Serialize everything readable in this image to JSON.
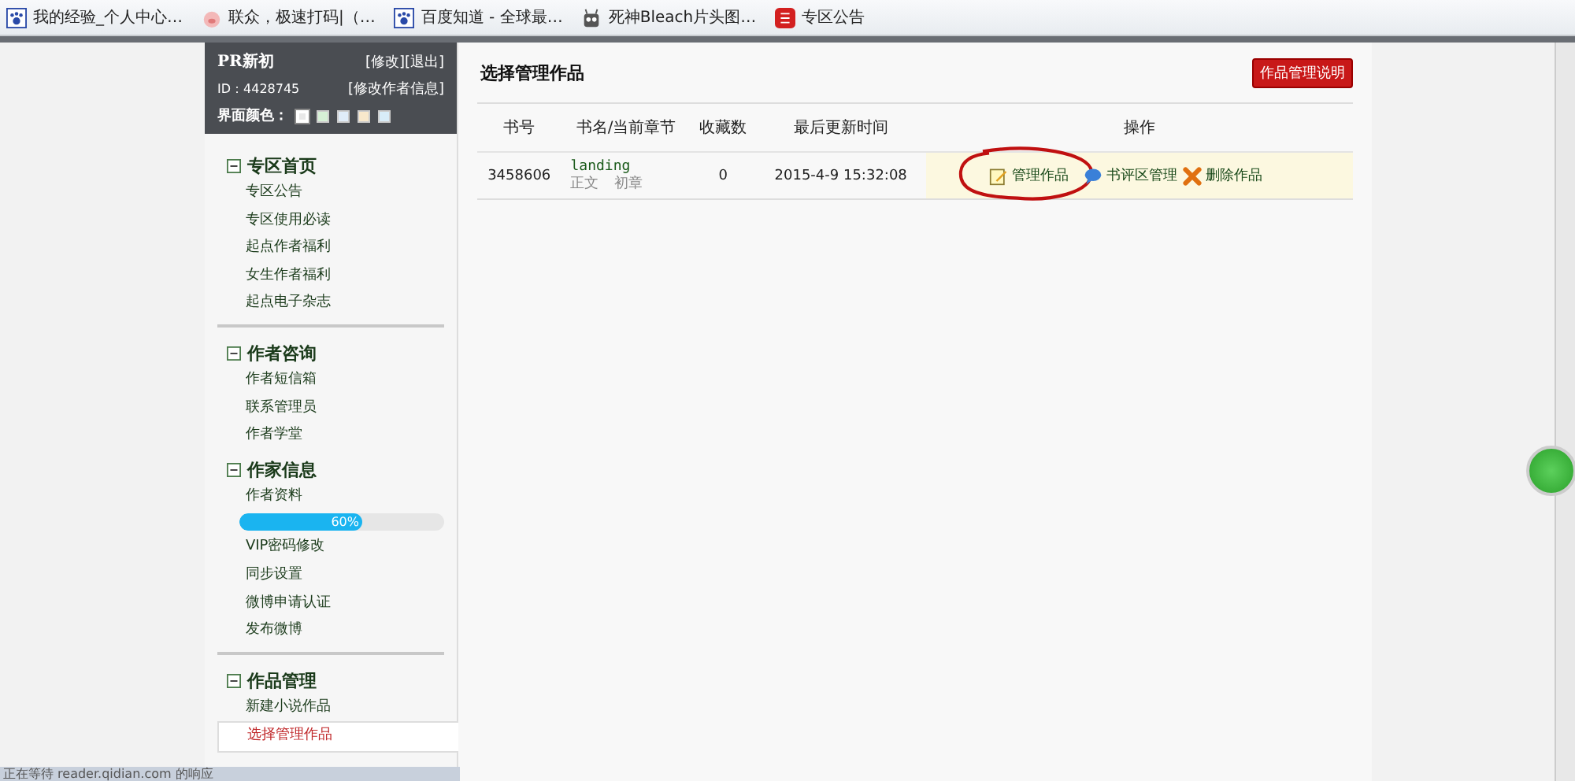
{
  "bookmarks": [
    {
      "label": "我的经验_个人中心…",
      "kind": "paw"
    },
    {
      "label": "联众，极速打码|（…",
      "kind": "pig"
    },
    {
      "label": "百度知道 - 全球最…",
      "kind": "paw"
    },
    {
      "label": "死神Bleach片头图…",
      "kind": "robot"
    },
    {
      "label": "专区公告",
      "kind": "red"
    }
  ],
  "user": {
    "name": "PR新初",
    "links": [
      "[修改]",
      "[退出]"
    ],
    "id": "ID：4428745",
    "edit_link": "[修改作者信息]",
    "theme_label": "界面颜色：",
    "themes": [
      {
        "color": "#e8e8e8",
        "selected": true
      },
      {
        "color": "#d6f0d6",
        "selected": false
      },
      {
        "color": "#e0ecf8",
        "selected": false
      },
      {
        "color": "#f8e8cc",
        "selected": false
      },
      {
        "color": "#d8ecf8",
        "selected": false
      }
    ]
  },
  "sidebar": [
    {
      "title": "专区首页",
      "expanded": true,
      "items": [
        {
          "label": "专区公告",
          "selected": false
        },
        {
          "label": "专区使用必读",
          "selected": false
        },
        {
          "label": "起点作者福利",
          "selected": false
        },
        {
          "label": "女生作者福利",
          "selected": false
        },
        {
          "label": "起点电子杂志",
          "selected": false
        }
      ]
    },
    {
      "title": "作者咨询",
      "expanded": true,
      "items": [
        {
          "label": "作者短信箱",
          "selected": false
        },
        {
          "label": "联系管理员",
          "selected": false
        },
        {
          "label": "作者学堂",
          "selected": false
        }
      ]
    },
    {
      "title": "作家信息",
      "expanded": true,
      "items": [
        {
          "label": "作者资料",
          "selected": false
        },
        {
          "kind": "progress",
          "level": 0.6,
          "reading": "60%"
        },
        {
          "label": "VIP密码修改",
          "selected": false
        },
        {
          "label": "同步设置",
          "selected": false
        },
        {
          "label": "微博申请认证",
          "selected": false
        },
        {
          "label": "发布微博",
          "selected": false
        }
      ]
    },
    {
      "title": "作品管理",
      "expanded": true,
      "items": [
        {
          "label": "新建小说作品",
          "selected": false
        },
        {
          "label": "选择管理作品",
          "selected": true
        }
      ]
    }
  ],
  "main": {
    "title": "选择管理作品",
    "help_button": "作品管理说明",
    "table": {
      "columns": [
        "书号",
        "书名/当前章节",
        "收藏数",
        "最后更新时间",
        "操作"
      ],
      "rows": [
        {
          "id": "3458606",
          "book": "landing",
          "chapter_type": "正文",
          "chapter": "初章",
          "favorites": "0",
          "updated": "2015-4-9 15:32:08",
          "actions": [
            {
              "label": "管理作品",
              "kind": "edit",
              "circled": true
            },
            {
              "label": "书评区管理",
              "kind": "comment",
              "circled": false
            },
            {
              "label": "删除作品",
              "kind": "delete",
              "circled": false
            }
          ]
        }
      ]
    }
  },
  "status_bar": "正在等待 reader.qidian.com 的响应"
}
